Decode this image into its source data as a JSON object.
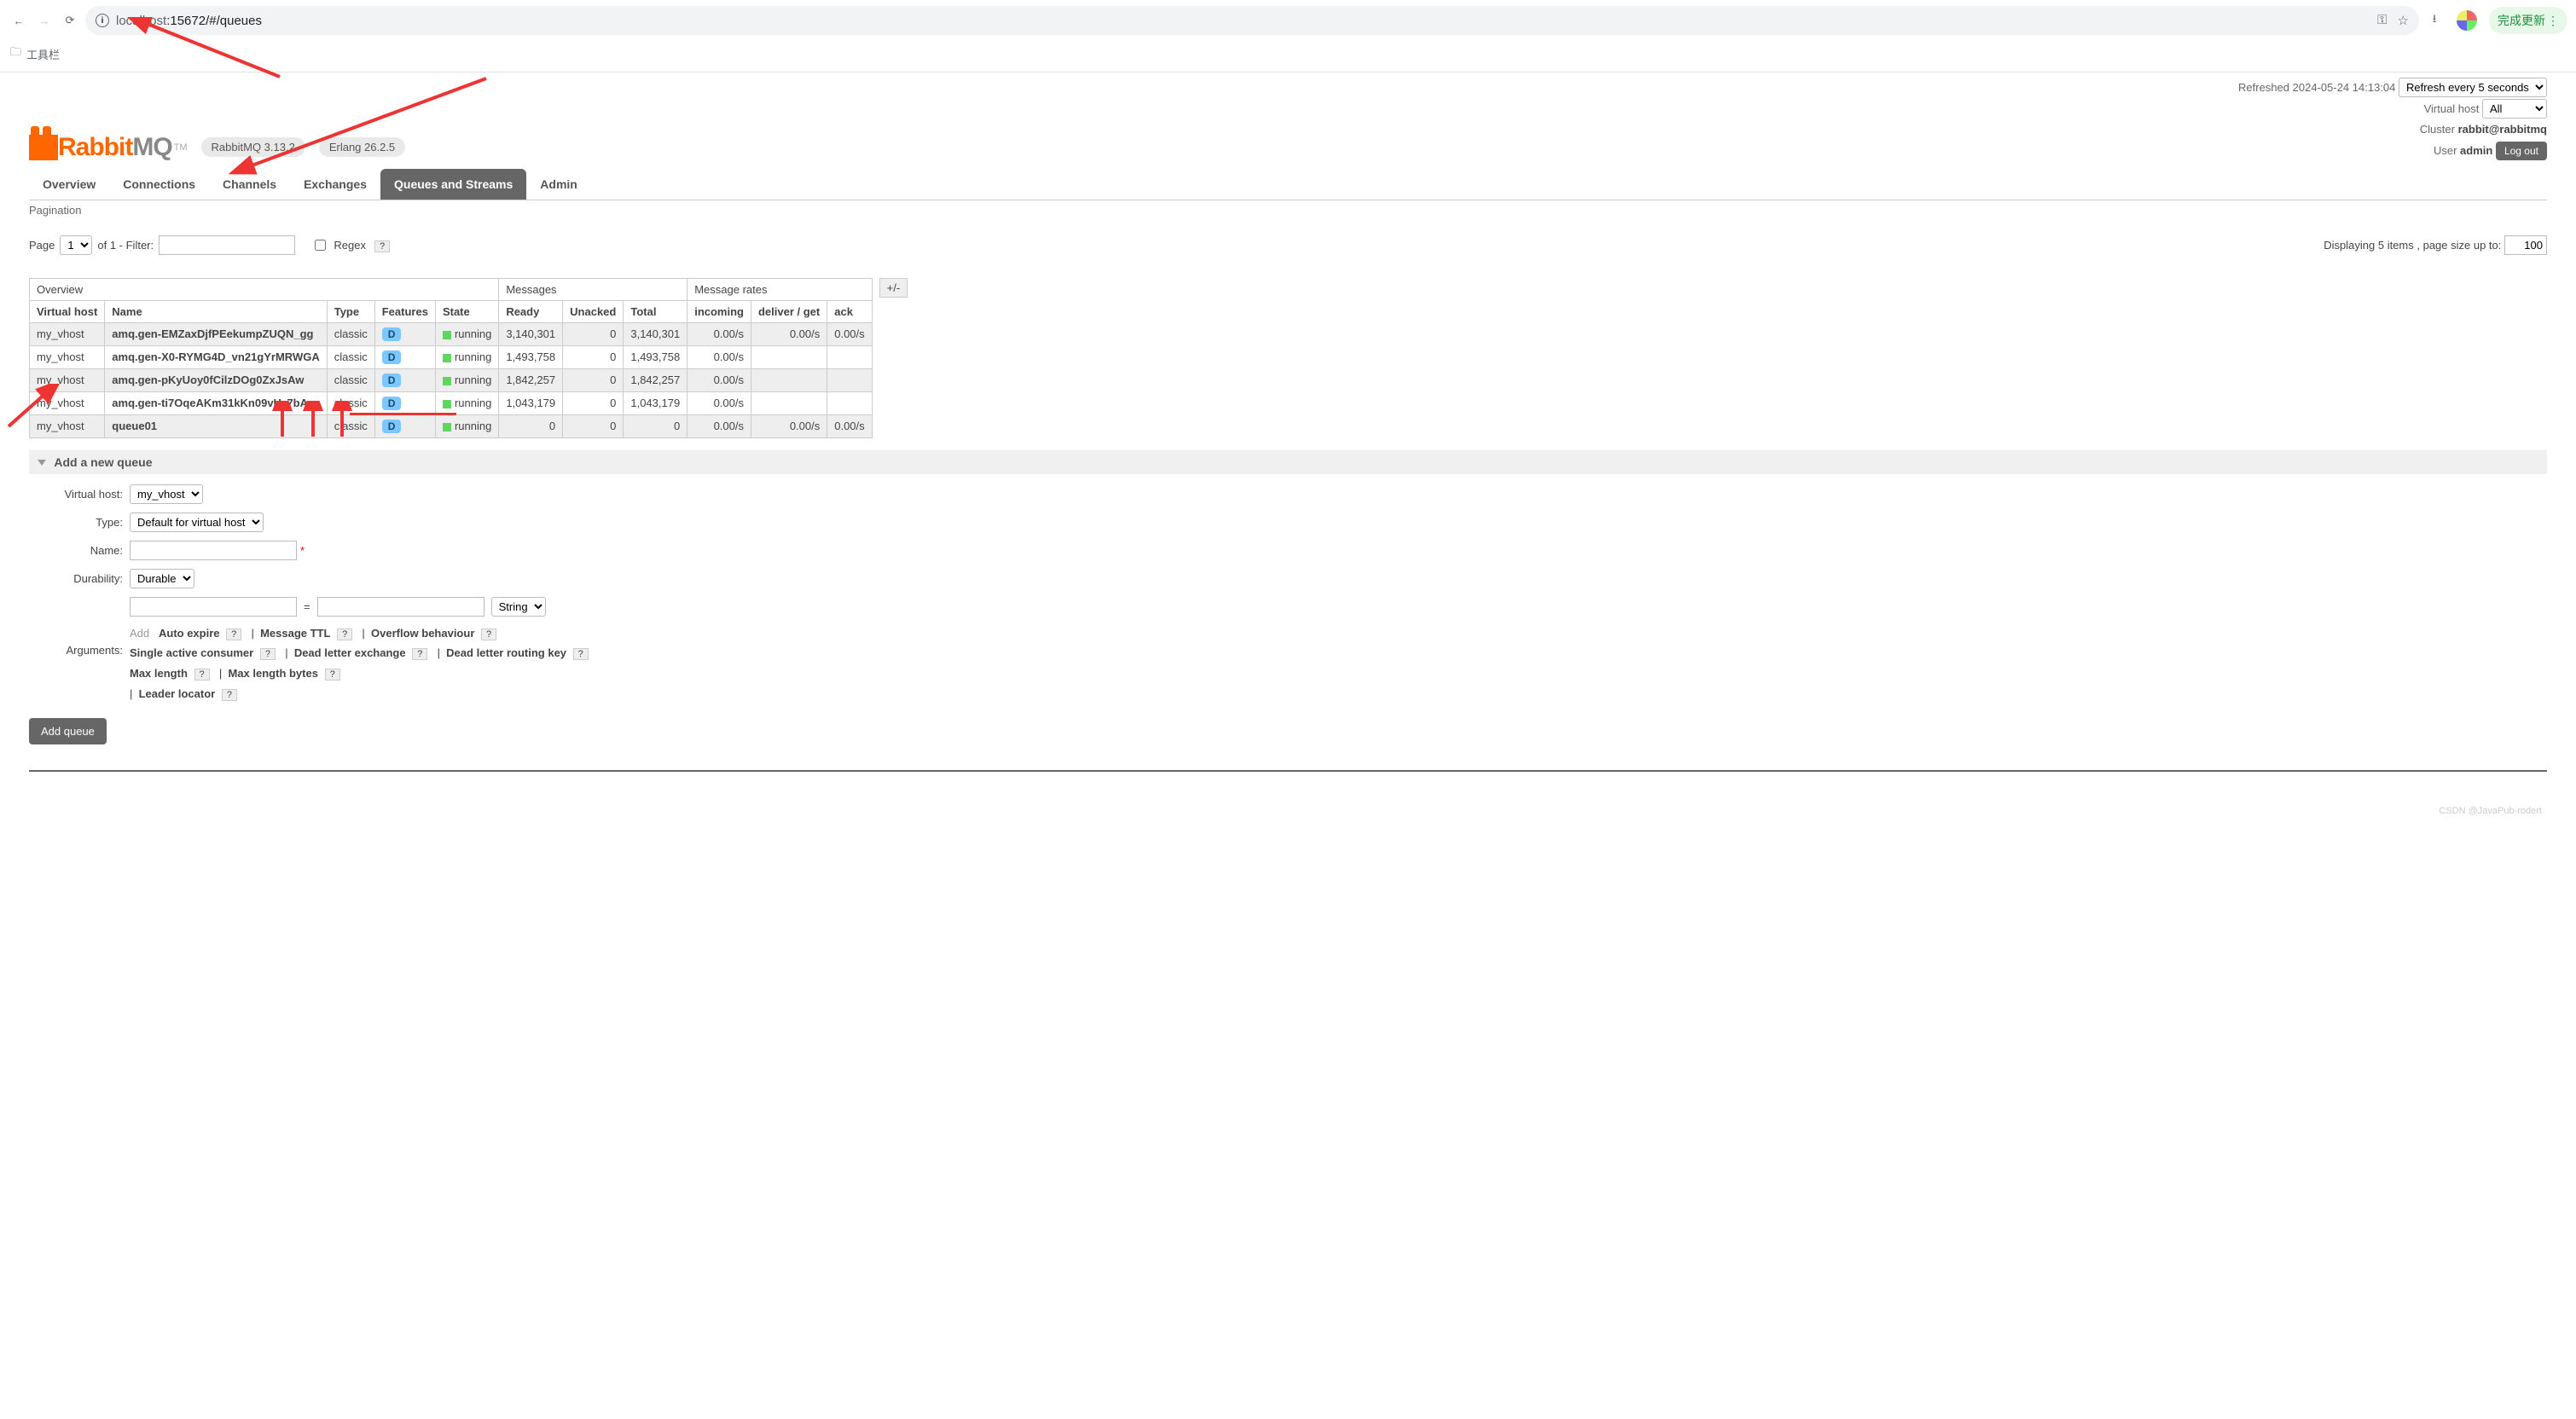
{
  "browser": {
    "url": "localhost:15672/#/queues",
    "url_host_prefix": "localhost",
    "url_rest": ":15672/#/queues",
    "bookmark_folder": "工具栏",
    "update_label": "完成更新"
  },
  "header": {
    "brand_prefix": "Rabbit",
    "brand_suffix": "MQ",
    "tm": "TM",
    "version_pill": "RabbitMQ 3.13.2",
    "erlang_pill": "Erlang 26.2.5",
    "refreshed_label": "Refreshed",
    "refreshed_time": "2024-05-24 14:13:04",
    "refresh_select": "Refresh every 5 seconds",
    "vhost_label": "Virtual host",
    "vhost_select": "All",
    "cluster_label": "Cluster",
    "cluster_value": "rabbit@rabbitmq",
    "user_label": "User",
    "user_value": "admin",
    "logout": "Log out"
  },
  "tabs": [
    "Overview",
    "Connections",
    "Channels",
    "Exchanges",
    "Queues and Streams",
    "Admin"
  ],
  "active_tab_index": 4,
  "pagination_label": "Pagination",
  "filter": {
    "page_label": "Page",
    "page_value": "1",
    "of_label": "of 1  - Filter:",
    "regex_label": "Regex",
    "display_text": "Displaying 5 items , page size up to:",
    "page_size": "100"
  },
  "table": {
    "group_headers": [
      "Overview",
      "Messages",
      "Message rates",
      ""
    ],
    "col_headers": [
      "Virtual host",
      "Name",
      "Type",
      "Features",
      "State",
      "Ready",
      "Unacked",
      "Total",
      "incoming",
      "deliver / get",
      "ack"
    ],
    "plus_minus": "+/-",
    "rows": [
      {
        "vhost": "my_vhost",
        "name": "amq.gen-EMZaxDjfPEekumpZUQN_gg",
        "type": "classic",
        "feat": "D",
        "state": "running",
        "ready": "3,140,301",
        "unacked": "0",
        "total": "3,140,301",
        "in": "0.00/s",
        "dg": "0.00/s",
        "ack": "0.00/s"
      },
      {
        "vhost": "my_vhost",
        "name": "amq.gen-X0-RYMG4D_vn21gYrMRWGA",
        "type": "classic",
        "feat": "D",
        "state": "running",
        "ready": "1,493,758",
        "unacked": "0",
        "total": "1,493,758",
        "in": "0.00/s",
        "dg": "",
        "ack": ""
      },
      {
        "vhost": "my_vhost",
        "name": "amq.gen-pKyUoy0fCilzDOg0ZxJsAw",
        "type": "classic",
        "feat": "D",
        "state": "running",
        "ready": "1,842,257",
        "unacked": "0",
        "total": "1,842,257",
        "in": "0.00/s",
        "dg": "",
        "ack": ""
      },
      {
        "vhost": "my_vhost",
        "name": "amq.gen-ti7OqeAKm31kKn09vHz7bA",
        "type": "classic",
        "feat": "D",
        "state": "running",
        "ready": "1,043,179",
        "unacked": "0",
        "total": "1,043,179",
        "in": "0.00/s",
        "dg": "",
        "ack": ""
      },
      {
        "vhost": "my_vhost",
        "name": "queue01",
        "type": "classic",
        "feat": "D",
        "state": "running",
        "ready": "0",
        "unacked": "0",
        "total": "0",
        "in": "0.00/s",
        "dg": "0.00/s",
        "ack": "0.00/s"
      }
    ]
  },
  "add_queue": {
    "section_title": "Add a new queue",
    "vhost_label": "Virtual host:",
    "vhost_value": "my_vhost",
    "type_label": "Type:",
    "type_value": "Default for virtual host",
    "name_label": "Name:",
    "durability_label": "Durability:",
    "durability_value": "Durable",
    "arguments_label": "Arguments:",
    "arg_type_value": "String",
    "add_word": "Add",
    "quick_args": [
      "Auto expire",
      "Message TTL",
      "Overflow behaviour",
      "Single active consumer",
      "Dead letter exchange",
      "Dead letter routing key",
      "Max length",
      "Max length bytes",
      "Leader locator"
    ],
    "button": "Add queue"
  },
  "watermark": "CSDN @JavaPub-rodert"
}
